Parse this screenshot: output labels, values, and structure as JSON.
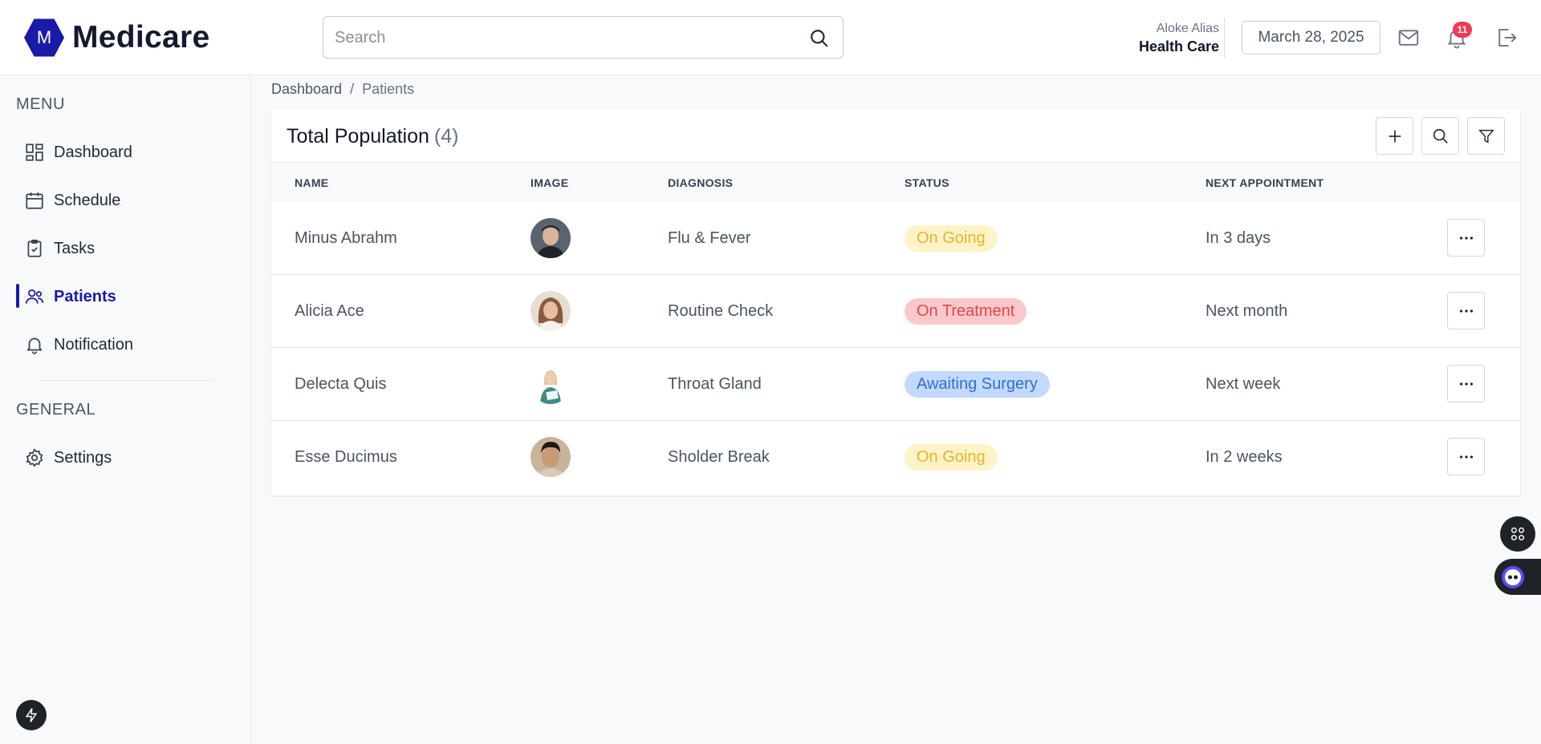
{
  "app": {
    "logo_letter": "M",
    "name": "Medicare"
  },
  "header": {
    "search_placeholder": "Search",
    "user_name": "Aloke Alias",
    "user_org": "Health Care",
    "date": "March 28, 2025",
    "notification_count": "11"
  },
  "sidebar": {
    "menu_title": "MENU",
    "general_title": "GENERAL",
    "items": [
      {
        "label": "Dashboard",
        "icon": "dashboard-icon"
      },
      {
        "label": "Schedule",
        "icon": "calendar-icon"
      },
      {
        "label": "Tasks",
        "icon": "clipboard-icon"
      },
      {
        "label": "Patients",
        "icon": "users-icon",
        "active": true
      },
      {
        "label": "Notification",
        "icon": "bell-icon"
      }
    ],
    "general_items": [
      {
        "label": "Settings",
        "icon": "gear-icon"
      }
    ]
  },
  "breadcrumb": {
    "root": "Dashboard",
    "separator": "/",
    "current": "Patients"
  },
  "panel": {
    "title": "Total Population",
    "count": "(4)"
  },
  "table": {
    "columns": [
      "NAME",
      "IMAGE",
      "DIAGNOSIS",
      "STATUS",
      "NEXT APPOINTMENT"
    ],
    "rows": [
      {
        "name": "Minus Abrahm",
        "diagnosis": "Flu & Fever",
        "status": "On Going",
        "status_kind": "ongoing",
        "next": "In 3 days"
      },
      {
        "name": "Alicia Ace",
        "diagnosis": "Routine Check",
        "status": "On Treatment",
        "status_kind": "treatment",
        "next": "Next month"
      },
      {
        "name": "Delecta Quis",
        "diagnosis": "Throat Gland",
        "status": "Awaiting Surgery",
        "status_kind": "surgery",
        "next": "Next week"
      },
      {
        "name": "Esse Ducimus",
        "diagnosis": "Sholder Break",
        "status": "On Going",
        "status_kind": "ongoing",
        "next": "In 2 weeks"
      }
    ]
  },
  "colors": {
    "brand": "#1a1aa8",
    "ongoing_bg": "#fdf3c7",
    "ongoing_text": "#e8b32a",
    "treatment_bg": "#f9c8cc",
    "treatment_text": "#e04848",
    "surgery_bg": "#c3dafc",
    "surgery_text": "#2f6fd8"
  }
}
